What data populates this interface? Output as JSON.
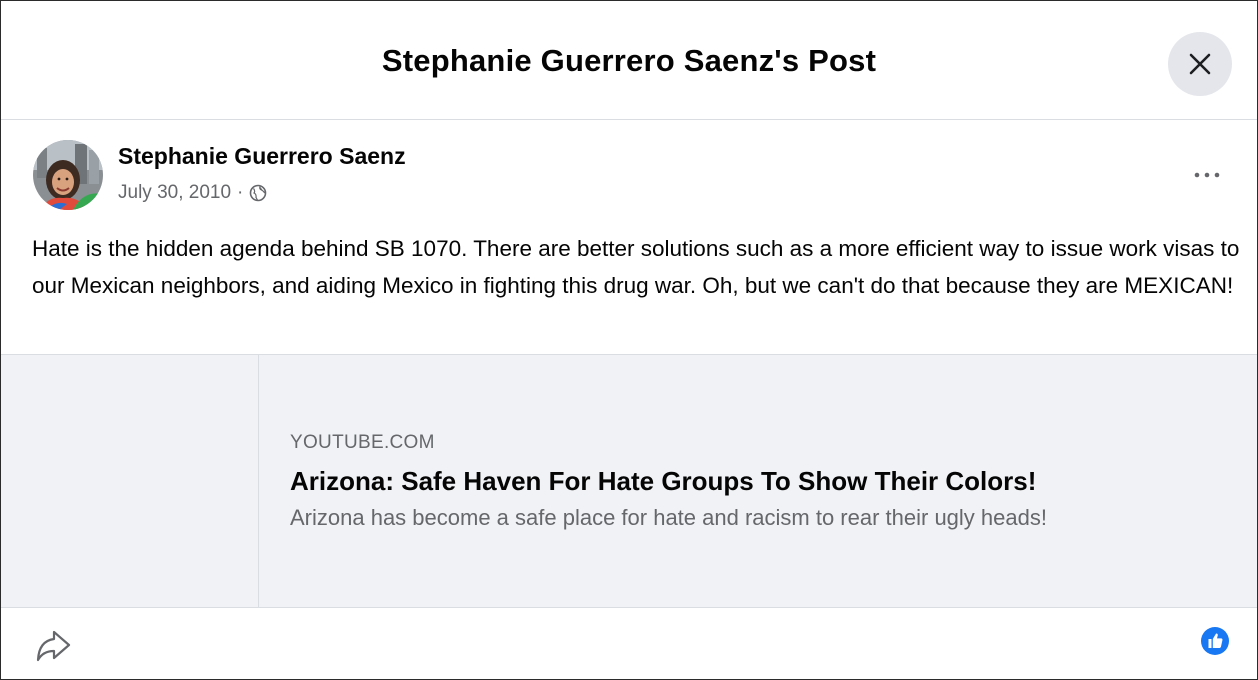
{
  "header": {
    "title": "Stephanie Guerrero Saenz's Post"
  },
  "post": {
    "author": "Stephanie Guerrero Saenz",
    "date": "July 30, 2010",
    "separator": "·",
    "audience_icon": "globe-icon",
    "text": "Hate is the hidden agenda behind SB 1070. There are better solutions such as a more efficient way to issue work visas to our Mexican neighbors, and aiding Mexico in fighting this drug war. Oh, but we can't do that because they are MEXICAN!"
  },
  "link_preview": {
    "domain": "YOUTUBE.COM",
    "title": "Arizona: Safe Haven For Hate Groups To Show Their Colors!",
    "description": "Arizona has become a safe place for hate and racism to rear their ugly heads!"
  },
  "actions": {
    "share_icon": "share-icon",
    "like_icon": "like-icon",
    "close_icon": "close-icon",
    "more_icon": "more-options-icon"
  },
  "colors": {
    "accent": "#1877f2",
    "secondary_text": "#65676b",
    "card_background": "#f0f2f5"
  }
}
